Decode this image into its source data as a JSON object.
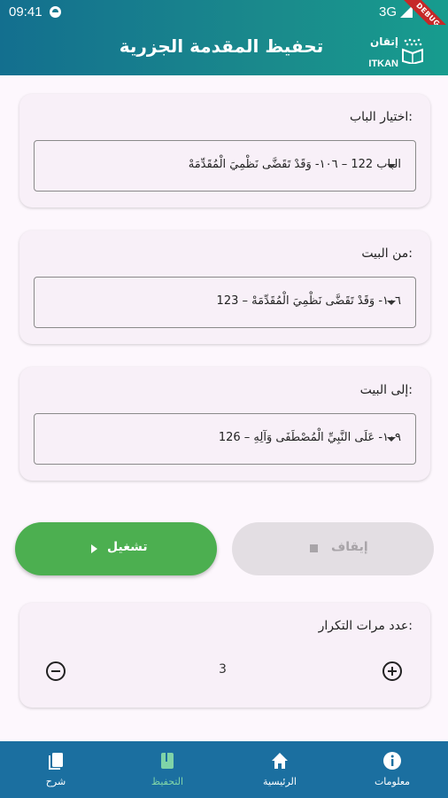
{
  "status_bar": {
    "time": "09:41",
    "network": "3G",
    "debug_label": "DEBUG"
  },
  "app_bar": {
    "title": "تحفيظ المقدمة الجزرية",
    "logo_ar": "إتقان",
    "logo_en": "ITKAN"
  },
  "chapter": {
    "label": ":اختيار الباب",
    "value": "الباب 122 – ١٠٦- وَقَدْ تَقَضَّى نَظْمِيَ الْمُقَدِّمَهْ"
  },
  "from_verse": {
    "label": ":من البيت",
    "value": "١٠٦- وَقَدْ تَقَضَّى نَظْمِيَ الْمُقَدِّمَهْ – 123"
  },
  "to_verse": {
    "label": ":إلى البيت",
    "value": "١٠٩- عَلَى النَّبِيِّ الْمُصْطَفَى وَآلِهِ – 126"
  },
  "controls": {
    "play_label": "تشغيل",
    "stop_label": "إيقاف"
  },
  "repeat": {
    "label": ":عدد مرات التكرار",
    "count": "3"
  },
  "bottom_nav": [
    {
      "label": "شرح",
      "icon": "books-icon"
    },
    {
      "label": "التحفيظ",
      "icon": "book-icon"
    },
    {
      "label": "الرئيسية",
      "icon": "home-icon"
    },
    {
      "label": "معلومات",
      "icon": "info-icon"
    }
  ],
  "colors": {
    "primary": "#1b6fa0",
    "accent_green": "#4caf50",
    "active_nav": "#7fd4a8",
    "background": "#fdf7fd"
  }
}
